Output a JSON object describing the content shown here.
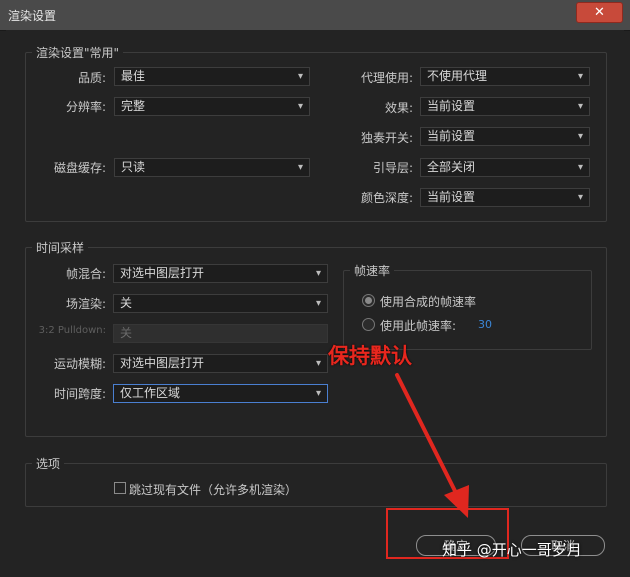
{
  "window": {
    "title": "渲染设置",
    "close_glyph": "✕"
  },
  "render_group": {
    "title": "渲染设置\"常用\"",
    "left": [
      {
        "label": "品质:",
        "value": "最佳"
      },
      {
        "label": "分辨率:",
        "value": "完整"
      },
      {
        "label": "磁盘缓存:",
        "value": "只读"
      }
    ],
    "right": [
      {
        "label": "代理使用:",
        "value": "不使用代理"
      },
      {
        "label": "效果:",
        "value": "当前设置"
      },
      {
        "label": "独奏开关:",
        "value": "当前设置"
      },
      {
        "label": "引导层:",
        "value": "全部关闭"
      },
      {
        "label": "颜色深度:",
        "value": "当前设置"
      }
    ]
  },
  "time_group": {
    "title": "时间采样",
    "rows": [
      {
        "label": "帧混合:",
        "value": "对选中图层打开"
      },
      {
        "label": "场渲染:",
        "value": "关"
      },
      {
        "label": "3:2 Pulldown:",
        "value": "关"
      },
      {
        "label": "运动模糊:",
        "value": "对选中图层打开"
      },
      {
        "label": "时间跨度:",
        "value": "仅工作区域"
      }
    ],
    "frame_rate": {
      "title": "帧速率",
      "option1": "使用合成的帧速率",
      "option2": "使用此帧速率:",
      "rate_value": "30"
    }
  },
  "options_group": {
    "title": "选项",
    "skip_existing": "跳过现有文件（允许多机渲染）"
  },
  "buttons": {
    "ok": "确定",
    "cancel": "取消"
  },
  "annotation": {
    "text": "保持默认",
    "color": "#e0271f"
  },
  "watermark": "知乎 @开心一哥岁月",
  "icons": {
    "chevron": "chevron-down-icon"
  }
}
